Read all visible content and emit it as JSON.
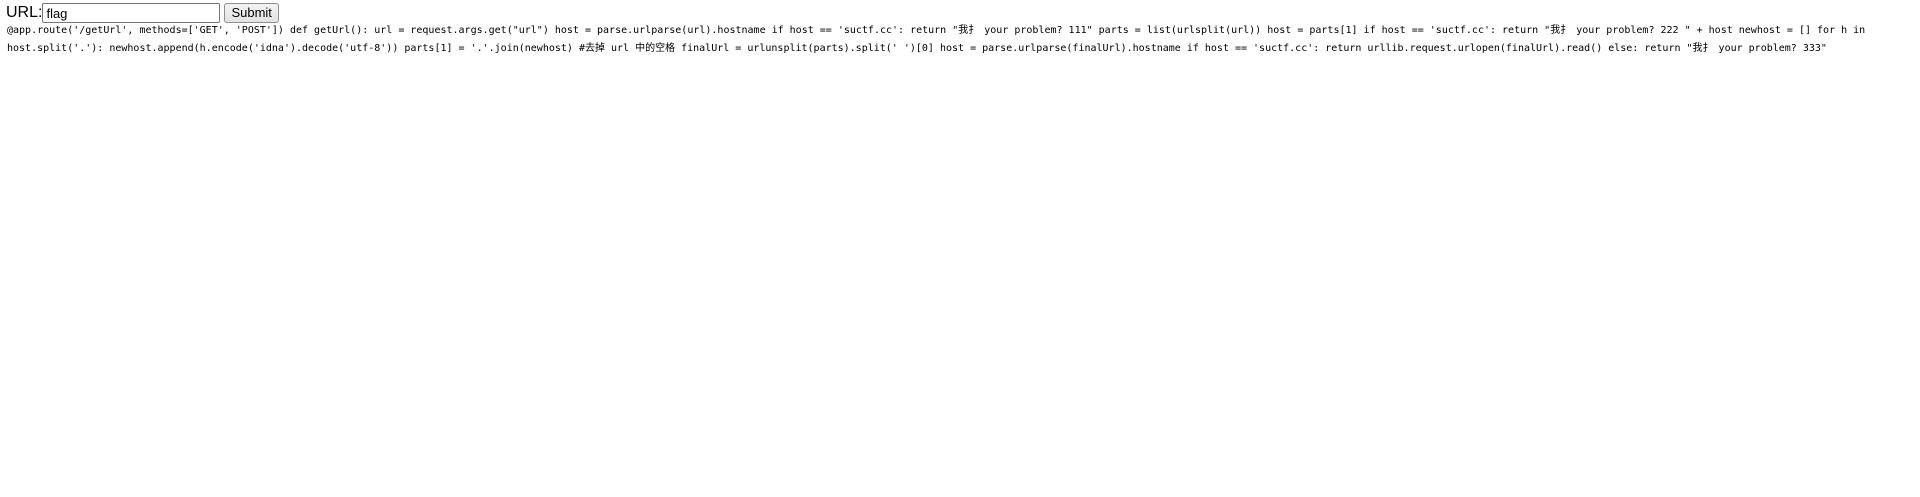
{
  "form": {
    "label": "URL:",
    "input_value": "flag",
    "submit_label": "Submit"
  },
  "source_code": "@app.route('/getUrl', methods=['GET', 'POST']) def getUrl(): url = request.args.get(\"url\") host = parse.urlparse(url).hostname if host == 'suctf.cc': return \"我扌 your problem? 111\" parts = list(urlsplit(url)) host = parts[1] if host == 'suctf.cc': return \"我扌 your problem? 222 \" + host newhost = [] for h in host.split('.'): newhost.append(h.encode('idna').decode('utf-8')) parts[1] = '.'.join(newhost) #去掉 url 中的空格 finalUrl = urlunsplit(parts).split(' ')[0] host = parse.urlparse(finalUrl).hostname if host == 'suctf.cc': return urllib.request.urlopen(finalUrl).read() else: return \"我扌 your problem? 333\""
}
